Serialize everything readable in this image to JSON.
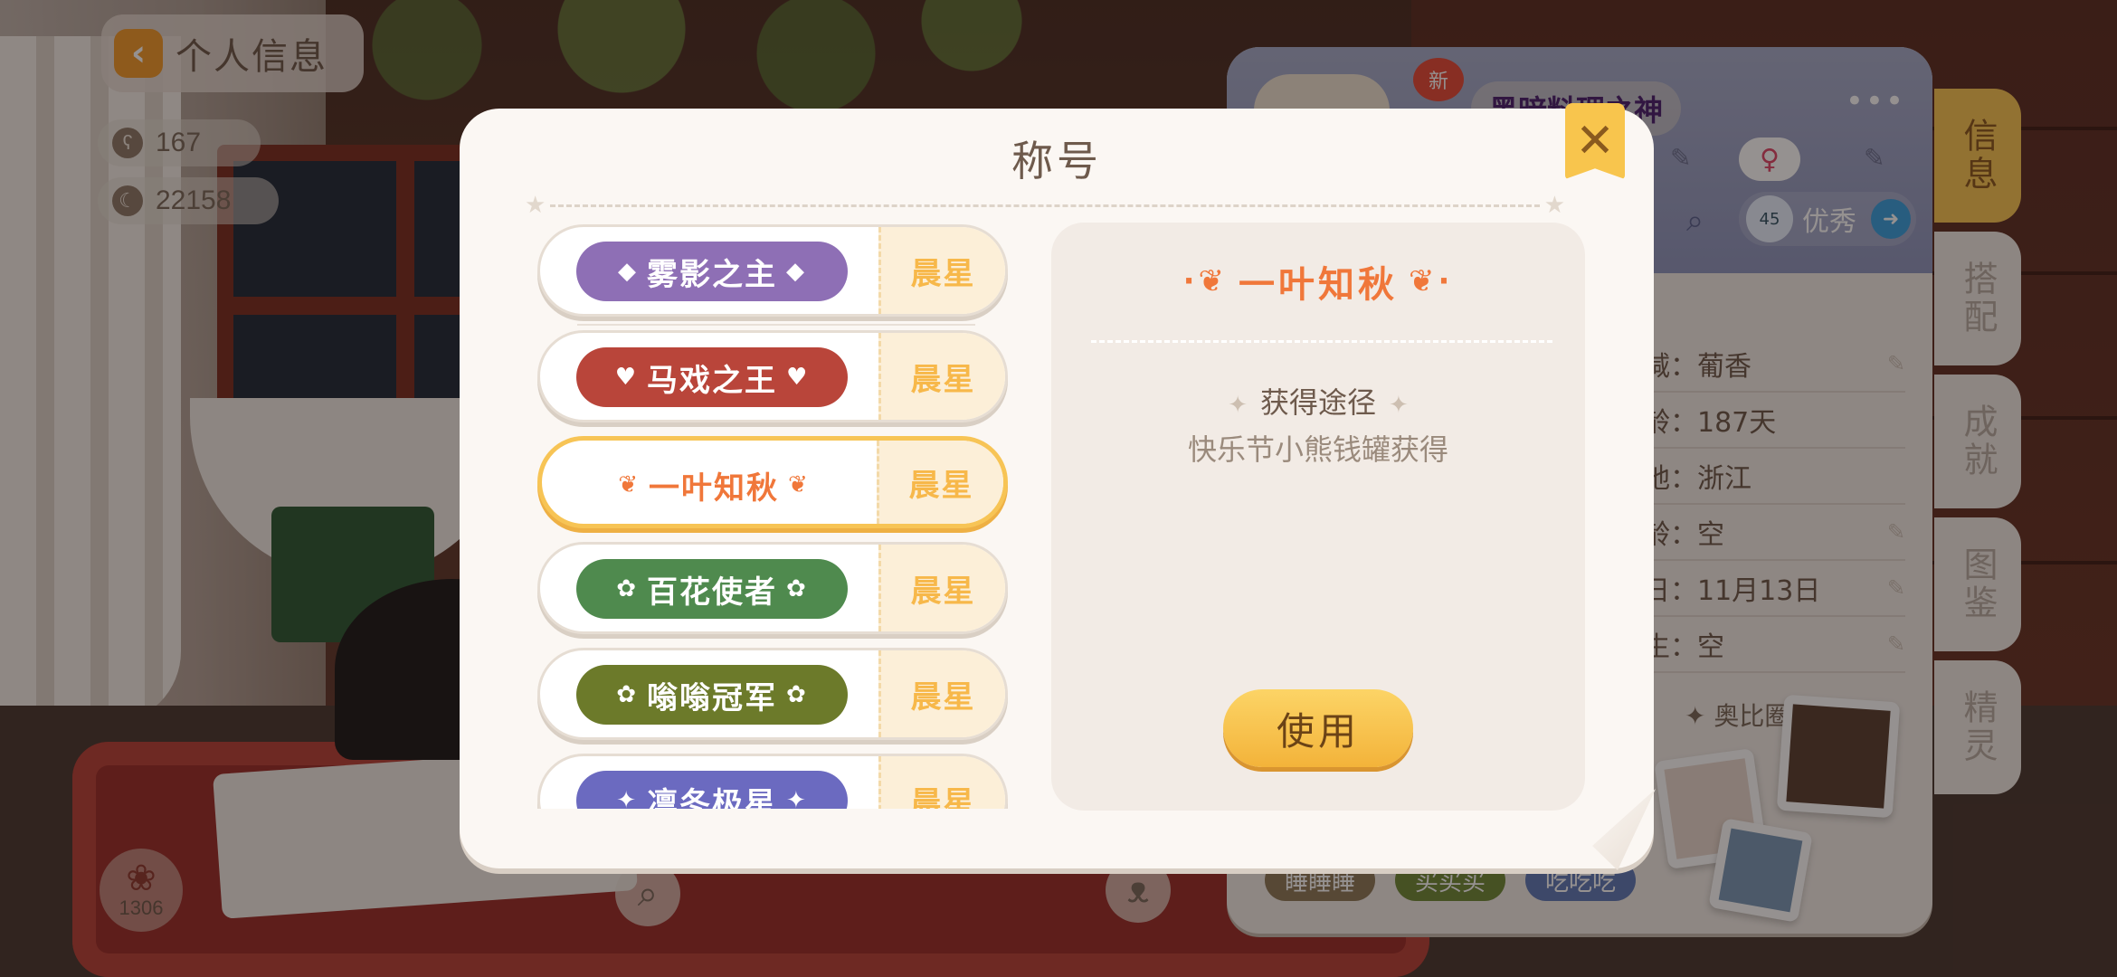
{
  "header": {
    "back_icon": "chevron-left-icon",
    "back_label": "个人信息"
  },
  "stats": {
    "bears": "167",
    "moon": "22158"
  },
  "bottom_hud": {
    "flower_count": "1306"
  },
  "profile": {
    "new_badge": "新",
    "name": "黑暗料理之神",
    "menu_icon": "more-dots-icon",
    "level": "45",
    "level_rating": "优秀",
    "info_rows": [
      {
        "value": "减：葡香"
      },
      {
        "value": "龄：187天"
      },
      {
        "value": "地：浙江"
      },
      {
        "value": "龄：空"
      },
      {
        "value": "日：11月13日"
      },
      {
        "value": "生：空"
      }
    ],
    "circle_title": "奥比圈",
    "tags": [
      "睡睡睡",
      "买买买",
      "吃吃吃"
    ]
  },
  "side_tabs": [
    "信息",
    "搭配",
    "成就",
    "图鉴",
    "精灵"
  ],
  "modal": {
    "title": "称号",
    "close_icon": "close-icon",
    "titles": [
      {
        "name": "雾影之主",
        "rank": "晨星",
        "color": "#8e6fb5",
        "deco": "◆"
      },
      {
        "name": "马戏之王",
        "rank": "晨星",
        "color": "#b9453a",
        "deco": "♥"
      },
      {
        "name": "一叶知秋",
        "rank": "晨星",
        "color": "#f0773a",
        "deco": "❦"
      },
      {
        "name": "百花使者",
        "rank": "晨星",
        "color": "#4f8a4e",
        "deco": "✿"
      },
      {
        "name": "嗡嗡冠军",
        "rank": "晨星",
        "color": "#6c7a2a",
        "deco": "✿"
      },
      {
        "name": "凛冬极星",
        "rank": "晨星",
        "color": "#6b6ac0",
        "deco": "✦"
      }
    ],
    "selected_title": "一叶知秋",
    "source_label": "获得途径",
    "source_desc": "快乐节小熊钱罐获得",
    "use_label": "使用"
  },
  "colors": {
    "accent": "#f8c54d",
    "rank": "#f7b84a",
    "selected_border": "#f7c455"
  }
}
